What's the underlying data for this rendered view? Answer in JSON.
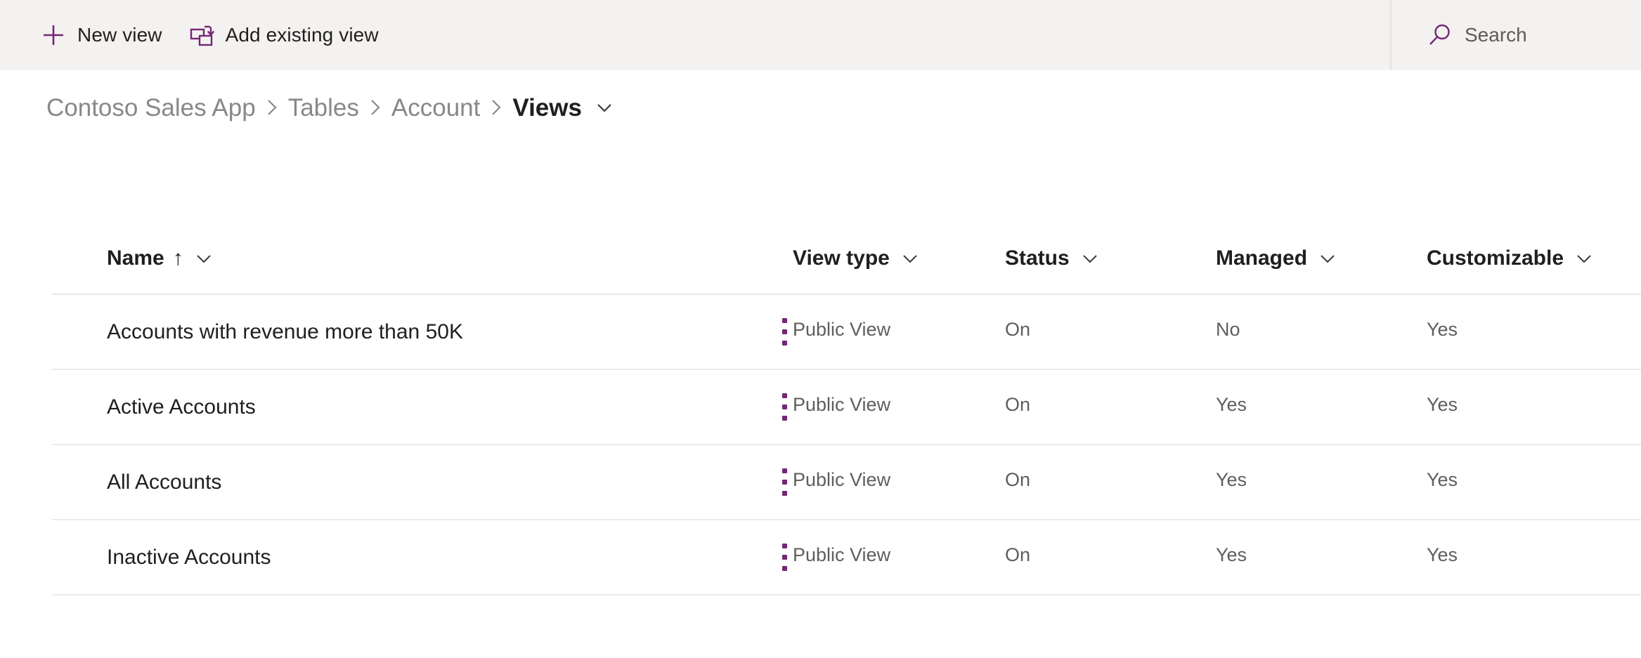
{
  "commandbar": {
    "buttons": [
      {
        "icon": "plus-icon",
        "label": "New view"
      },
      {
        "icon": "add-existing-view-icon",
        "label": "Add existing view"
      }
    ],
    "search": {
      "icon": "search-icon",
      "placeholder": "Search",
      "value": ""
    },
    "background_color": "#f3f2f1",
    "accent_color": "#742774"
  },
  "breadcrumb": {
    "items": [
      {
        "label": "Contoso Sales App",
        "current": false
      },
      {
        "label": "Tables",
        "current": false
      },
      {
        "label": "Account",
        "current": false
      },
      {
        "label": "Views",
        "current": true
      }
    ],
    "separator": "chevron-right-icon",
    "dropdown": "chevron-down-icon"
  },
  "grid": {
    "columns": [
      {
        "key": "name",
        "label": "Name",
        "sorted": "ascending",
        "sort_glyph": "↑"
      },
      {
        "key": "view_type",
        "label": "View type"
      },
      {
        "key": "status",
        "label": "Status"
      },
      {
        "key": "managed",
        "label": "Managed"
      },
      {
        "key": "customizable",
        "label": "Customizable"
      }
    ],
    "rows": [
      {
        "name": "Accounts with revenue more than 50K",
        "view_type": "Public View",
        "status": "On",
        "managed": "No",
        "customizable": "Yes"
      },
      {
        "name": "Active Accounts",
        "view_type": "Public View",
        "status": "On",
        "managed": "Yes",
        "customizable": "Yes"
      },
      {
        "name": "All Accounts",
        "view_type": "Public View",
        "status": "On",
        "managed": "Yes",
        "customizable": "Yes"
      },
      {
        "name": "Inactive Accounts",
        "view_type": "Public View",
        "status": "On",
        "managed": "Yes",
        "customizable": "Yes"
      }
    ],
    "row_menu_icon": "more-vertical-icon"
  }
}
